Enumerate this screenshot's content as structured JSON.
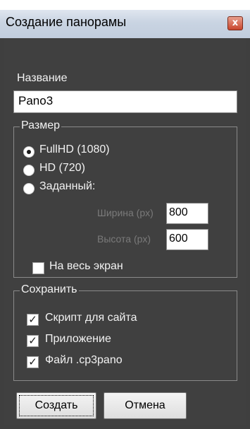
{
  "window": {
    "title": "Создание панорамы",
    "close_label": "x"
  },
  "name_field": {
    "label": "Название",
    "value": "Pano3"
  },
  "size_group": {
    "title": "Размер",
    "options": [
      {
        "label": "FullHD (1080)",
        "selected": true
      },
      {
        "label": "HD (720)",
        "selected": false
      },
      {
        "label": "Заданный:",
        "selected": false
      }
    ],
    "width_label": "Ширина (px)",
    "width_value": "800",
    "height_label": "Высота (px)",
    "height_value": "600",
    "fullscreen_label": "На весь экран",
    "fullscreen_checked": false
  },
  "save_group": {
    "title": "Сохранить",
    "options": [
      {
        "label": "Скрипт для сайта",
        "checked": true
      },
      {
        "label": "Приложение",
        "checked": true
      },
      {
        "label": "Файл .cp3pano",
        "checked": true
      }
    ]
  },
  "buttons": {
    "create": "Создать",
    "cancel": "Отмена"
  }
}
